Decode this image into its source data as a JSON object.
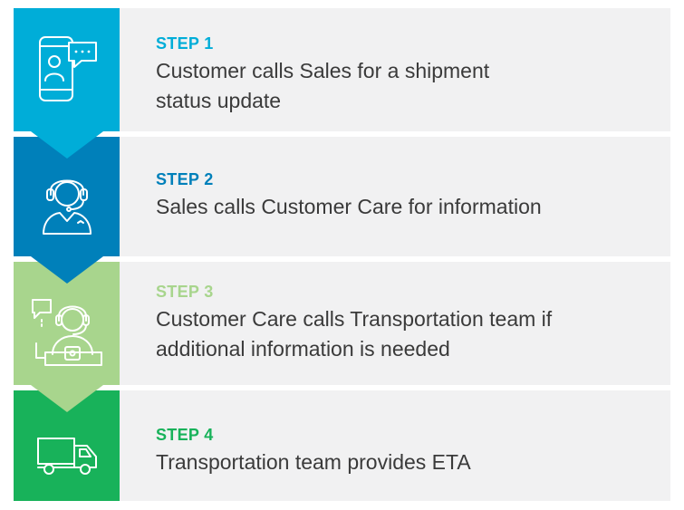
{
  "colors": {
    "step1": "#00ADD8",
    "step2": "#0080BA",
    "step3": "#A8D58D",
    "step4": "#18B25A",
    "row_background": "#F1F1F2",
    "text": "#3A3A3A"
  },
  "steps": [
    {
      "label": "STEP 1",
      "description_lines": [
        "Customer calls Sales for a shipment",
        "status update"
      ],
      "icon": "smartphone-chat-icon"
    },
    {
      "label": "STEP 2",
      "description_lines": [
        "Sales calls Customer Care for information"
      ],
      "icon": "headset-agent-icon"
    },
    {
      "label": "STEP 3",
      "description_lines": [
        "Customer Care calls Transportation team if",
        "additional information is needed"
      ],
      "icon": "agent-at-desk-chat-icon"
    },
    {
      "label": "STEP 4",
      "description_lines": [
        "Transportation team provides ETA"
      ],
      "icon": "delivery-truck-icon"
    }
  ]
}
